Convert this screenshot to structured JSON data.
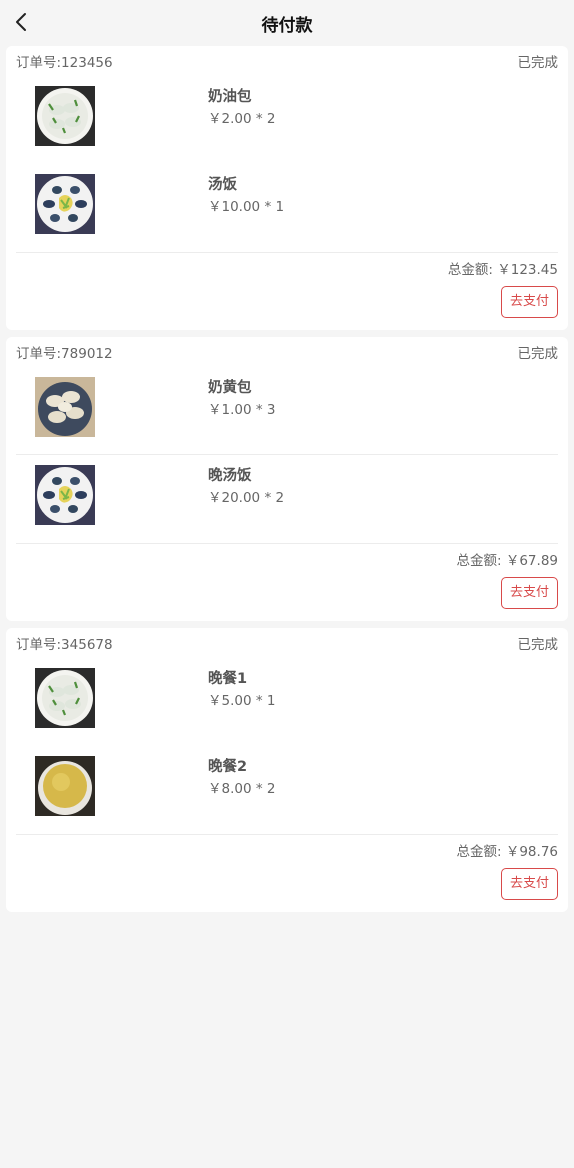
{
  "header": {
    "title": "待付款",
    "back_icon": "chevron-left-icon"
  },
  "orders": [
    {
      "order_no": "订单号:123456",
      "status": "已完成",
      "items": [
        {
          "name": "奶油包",
          "price": "￥2.00 * 2",
          "image": "dumpling-plate"
        },
        {
          "name": "汤饭",
          "price": "￥10.00 * 1",
          "image": "egg-plate"
        }
      ],
      "total_label": "总金额:",
      "total": "￥123.45",
      "pay_label": "去支付"
    },
    {
      "order_no": "订单号:789012",
      "status": "已完成",
      "items": [
        {
          "name": "奶黄包",
          "price": "￥1.00 * 3",
          "image": "dumpling-dark-plate"
        },
        {
          "name": "晚汤饭",
          "price": "￥20.00 * 2",
          "image": "egg-plate"
        }
      ],
      "total_label": "总金额:",
      "total": "￥67.89",
      "pay_label": "去支付"
    },
    {
      "order_no": "订单号:345678",
      "status": "已完成",
      "items": [
        {
          "name": "晚餐1",
          "price": "￥5.00 * 1",
          "image": "dumpling-plate"
        },
        {
          "name": "晚餐2",
          "price": "￥8.00 * 2",
          "image": "soup-bowl"
        }
      ],
      "total_label": "总金额:",
      "total": "￥98.76",
      "pay_label": "去支付"
    }
  ],
  "colors": {
    "accent": "#d84a4a",
    "background": "#f5f5f5",
    "card": "#ffffff"
  }
}
